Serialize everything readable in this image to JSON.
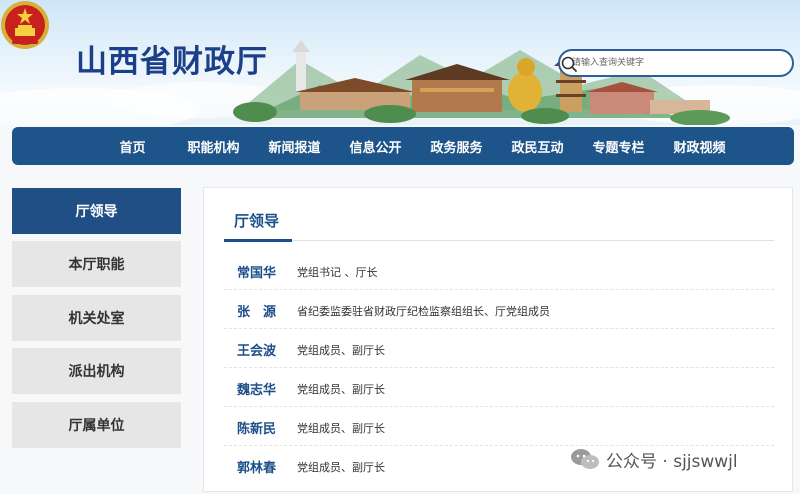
{
  "header": {
    "site_title": "山西省财政厅",
    "search_placeholder": "请输入查询关键字",
    "emblem_icon": "national-emblem-icon"
  },
  "nav": {
    "items": [
      "首页",
      "职能机构",
      "新闻报道",
      "信息公开",
      "政务服务",
      "政民互动",
      "专题专栏",
      "财政视频"
    ]
  },
  "sidebar": {
    "items": [
      {
        "label": "厅领导",
        "active": true
      },
      {
        "label": "本厅职能",
        "active": false
      },
      {
        "label": "机关处室",
        "active": false
      },
      {
        "label": "派出机构",
        "active": false
      },
      {
        "label": "厅属单位",
        "active": false
      }
    ]
  },
  "main": {
    "title": "厅领导",
    "leaders": [
      {
        "name": "常国华",
        "role": "党组书记 、厅长"
      },
      {
        "name": "张　源",
        "role": "省纪委监委驻省财政厅纪检监察组组长、厅党组成员"
      },
      {
        "name": "王会波",
        "role": "党组成员、副厅长"
      },
      {
        "name": "魏志华",
        "role": "党组成员、副厅长"
      },
      {
        "name": "陈新民",
        "role": "党组成员、副厅长"
      },
      {
        "name": "郭林春",
        "role": "党组成员、副厅长"
      }
    ]
  },
  "watermark": {
    "text": "公众号 · sjjswwjl"
  },
  "colors": {
    "nav_bg": "#1d548a",
    "title_blue": "#1c3f8a",
    "sidebar_active": "#1f4f85",
    "sidebar_inactive": "#e6e6e6"
  }
}
